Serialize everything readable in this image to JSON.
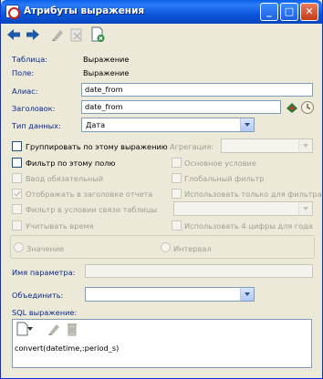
{
  "window": {
    "title": "Атрибуты выражения",
    "minimize_label": "_",
    "maximize_label": "□",
    "close_label": "✕"
  },
  "toolbar": {
    "back_icon": "arrow-left-icon",
    "forward_icon": "arrow-right-icon",
    "edit_icon": "pen-icon",
    "delete_icon": "delete-icon",
    "new_icon": "new-document-icon"
  },
  "info": {
    "table_label": "Таблица:",
    "table_value": "Выражение",
    "field_label": "Поле:",
    "field_value": "Выражение"
  },
  "form": {
    "alias_label": "Алиас:",
    "alias_value": "date_from",
    "caption_label": "Заголовок:",
    "caption_value": "date_from",
    "datatype_label": "Тип данных:",
    "datatype_value": "Дата",
    "param_label": "Имя параметра:",
    "param_value": "",
    "combine_label": "Объединить:",
    "combine_value": "",
    "sql_label": "SQL выражение:",
    "sql_value": "convert(datetime,:period_s)"
  },
  "options": {
    "group_by": "Группировать по этому выражению",
    "aggregation_label": "Агрегация:",
    "filter_by": "Фильтр по этому полю",
    "main_condition": "Основное условие",
    "input_required": "Ввод обязательный",
    "global_filter": "Глобальный фильтр",
    "show_in_header": "Отображать в заголовке отчета",
    "filter_only": "Использовать только для фильтра",
    "filter_in_join": "Фильтр в условии связи таблицы",
    "consider_time": "Учитывать время",
    "use_4_digits": "Использовать 4 цифры для года",
    "radio_value": "Значение",
    "radio_interval": "Интервал"
  },
  "colors": {
    "titlebar": "#0A58DC",
    "window_bg": "#ECE9D8",
    "label_blue": "#0B2A8E",
    "disabled_text": "#A09E92"
  }
}
